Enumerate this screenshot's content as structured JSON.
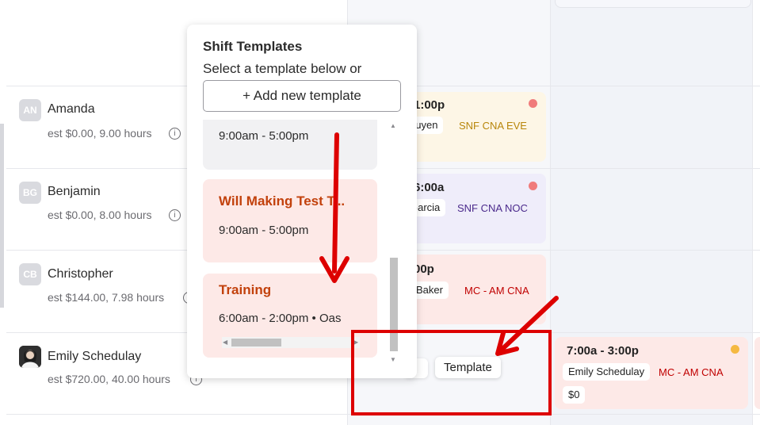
{
  "employees": [
    {
      "initials": "AN",
      "name": "Amanda",
      "estimate": "est $0.00, 9.00 hours"
    },
    {
      "initials": "BG",
      "name": "Benjamin",
      "estimate": "est $0.00, 8.00 hours"
    },
    {
      "initials": "CB",
      "name": "Christopher",
      "estimate": "est $144.00, 7.98 hours"
    },
    {
      "initials": "",
      "name": "Emily Schedulay",
      "estimate": "est $720.00, 40.00 hours"
    }
  ],
  "info_glyph": "i",
  "shifts": [
    {
      "time": "1:00p",
      "person": "guyen",
      "role": "SNF CNA EVE",
      "role_color": "#b8860b",
      "bg": "#fdf6e6",
      "dot": "#f07b7b"
    },
    {
      "time": "6:00a",
      "person": "Garcia",
      "role": "SNF CNA NOC",
      "role_color": "#4b2a8c",
      "bg": "#efedfa",
      "dot": "#f07b7b"
    },
    {
      "time": "00p",
      "person": "r Baker",
      "role": "MC - AM CNA",
      "role_color": "#c00000",
      "bg": "#fde9e7"
    },
    {
      "time": "7:00a - 3:00p",
      "person": "Emily Schedulay",
      "role": "MC - AM CNA",
      "role_color": "#c00000",
      "pay": "$0",
      "bg": "#fde9e7",
      "dot": "#f5b942"
    }
  ],
  "popup": {
    "title": "Shift Templates",
    "subtitle": "Select a template below or",
    "add_button": "+ Add new template",
    "templates": [
      {
        "name": "",
        "time": "9:00am - 5:00pm"
      },
      {
        "name": "Will Making Test T...",
        "time": "9:00am - 5:00pm"
      },
      {
        "name": "Training",
        "time": "6:00am - 2:00pm • Oas"
      }
    ]
  },
  "tooltip": "Template",
  "colors": {
    "annotation_red": "#dd0000"
  }
}
